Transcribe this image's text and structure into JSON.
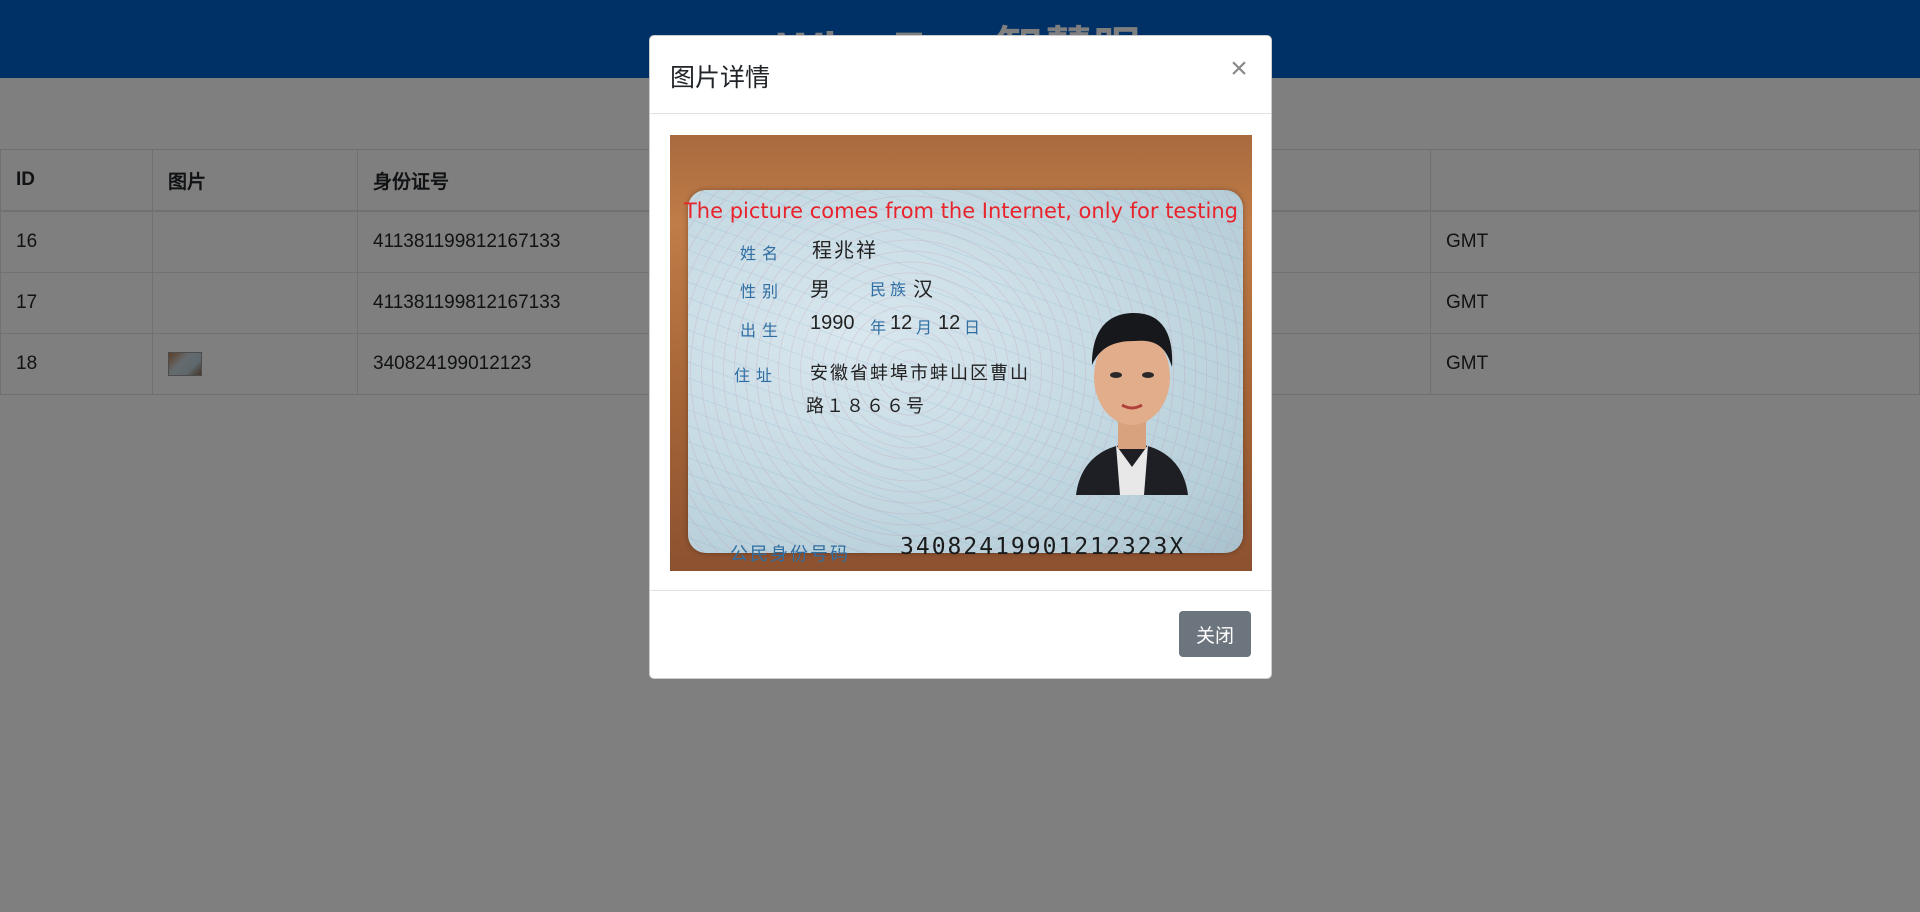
{
  "header": {
    "title": "WiseEye 智慧眼"
  },
  "table": {
    "columns": [
      "ID",
      "图片",
      "身份证号",
      "",
      "",
      ""
    ],
    "rows": [
      {
        "id": "16",
        "has_image": false,
        "id_number": "411381199812167133",
        "c4": "",
        "c5": "",
        "c6": "GMT"
      },
      {
        "id": "17",
        "has_image": false,
        "id_number": "411381199812167133",
        "c4": "",
        "c5": "",
        "c6": "GMT"
      },
      {
        "id": "18",
        "has_image": true,
        "id_number": "340824199012123",
        "c4": "",
        "c5": "",
        "c6": "GMT"
      }
    ]
  },
  "modal": {
    "title": "图片详情",
    "close_icon": "close-icon",
    "close_button_label": "关闭",
    "image": {
      "watermark": "The picture comes from the Internet, only for testing",
      "name_label": "姓名",
      "name_value": "程兆祥",
      "sex_label": "性别",
      "sex_value": "男",
      "ethnicity_label": "民族",
      "ethnicity_value": "汉",
      "birth_label": "出生",
      "birth_year": "1990",
      "year_char": "年",
      "birth_month": "12",
      "month_char": "月",
      "birth_day": "12",
      "day_char": "日",
      "address_label": "住址",
      "address_line1": "安徽省蚌埠市蚌山区曹山",
      "address_line2": "路１８６６号",
      "id_label": "公民身份号码",
      "id_value": "34082419901212323X"
    }
  },
  "colors": {
    "header_bg": "#0062cc",
    "button_secondary": "#6c757d",
    "watermark": "#e8232b"
  }
}
